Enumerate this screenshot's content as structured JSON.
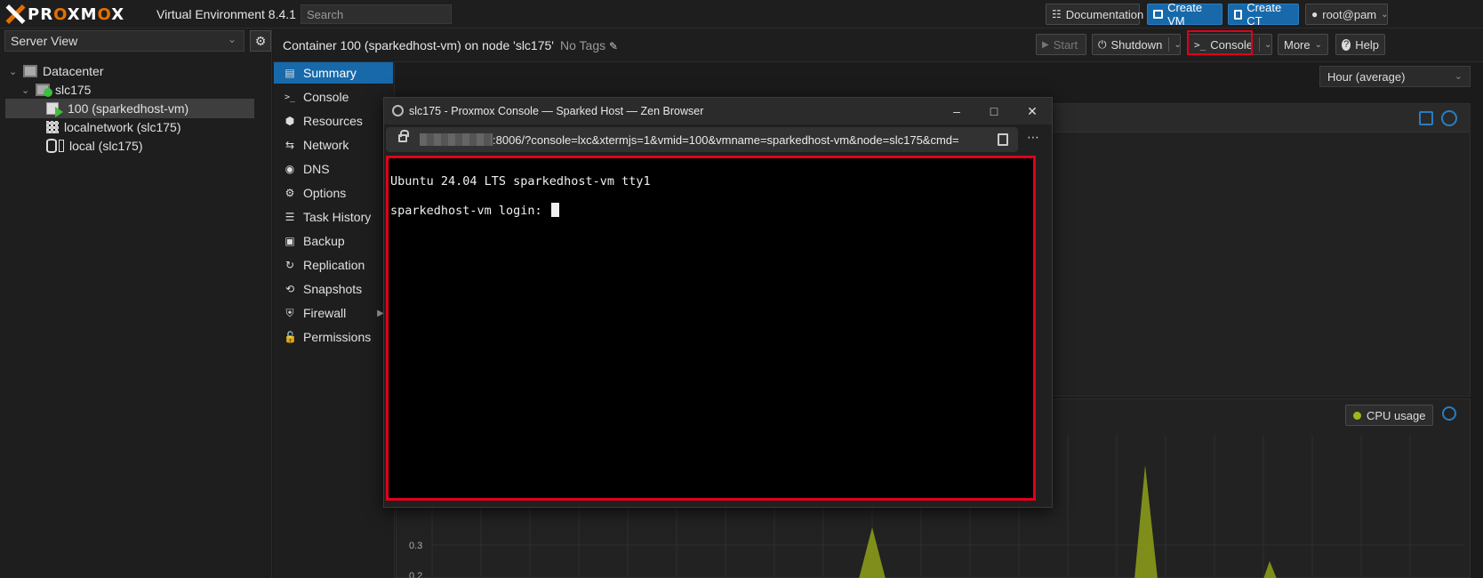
{
  "app": {
    "logo_text_left": "PR",
    "logo_text_o1": "O",
    "logo_text_mid": "XM",
    "logo_text_o2": "O",
    "logo_text_right": "X",
    "version": "Virtual Environment 8.4.1",
    "search_placeholder": "Search"
  },
  "topbar": {
    "documentation": "Documentation",
    "create_vm": "Create VM",
    "create_ct": "Create CT",
    "user": "root@pam"
  },
  "left": {
    "view": "Server View",
    "tree": [
      {
        "label": "Datacenter"
      },
      {
        "label": "slc175"
      },
      {
        "label": "100 (sparkedhost-vm)"
      },
      {
        "label": "localnetwork (slc175)"
      },
      {
        "label": "local (slc175)"
      }
    ]
  },
  "header": {
    "title": "Container 100 (sparkedhost-vm) on node 'slc175'",
    "tags": "No Tags",
    "start": "Start",
    "shutdown": "Shutdown",
    "console": "Console",
    "more": "More",
    "help": "Help"
  },
  "nav": [
    {
      "label": "Summary",
      "icon": "summary-icon"
    },
    {
      "label": "Console",
      "icon": "terminal-icon"
    },
    {
      "label": "Resources",
      "icon": "cube-icon"
    },
    {
      "label": "Network",
      "icon": "network-icon"
    },
    {
      "label": "DNS",
      "icon": "globe-icon"
    },
    {
      "label": "Options",
      "icon": "gear-icon"
    },
    {
      "label": "Task History",
      "icon": "list-icon"
    },
    {
      "label": "Backup",
      "icon": "floppy-icon"
    },
    {
      "label": "Replication",
      "icon": "retweet-icon"
    },
    {
      "label": "Snapshots",
      "icon": "history-icon"
    },
    {
      "label": "Firewall",
      "icon": "shield-icon"
    },
    {
      "label": "Permissions",
      "icon": "unlock-icon"
    }
  ],
  "content": {
    "timeframe": "Hour (average)",
    "cpu_legend": "CPU usage",
    "y_tick_label": "0.3",
    "y_tick_label_bottom": "0.2"
  },
  "popup": {
    "title": "slc175 - Proxmox Console — Sparked Host — Zen Browser",
    "url": ":8006/?console=lxc&xtermjs=1&vmid=100&vmname=sparkedhost-vm&node=slc175&cmd=",
    "term_line1": "Ubuntu 24.04 LTS sparkedhost-vm tty1",
    "term_line2": "sparkedhost-vm login: "
  },
  "colors": {
    "accent": "#1769aa",
    "highlight": "#e0001b",
    "brand_orange": "#e57000",
    "cpu_series": "#9cb91b"
  }
}
